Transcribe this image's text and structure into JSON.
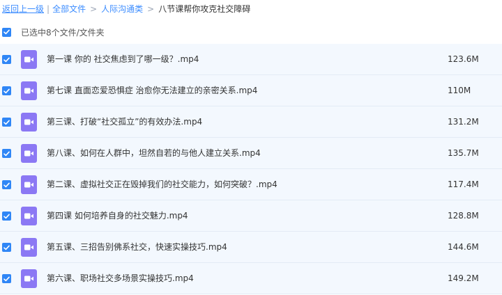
{
  "breadcrumb": {
    "back_label": "返回上一级",
    "separator": "|",
    "root_label": "全部文件",
    "folder_label": "人际沟通类",
    "current_label": "八节课帮你攻克社交障碍",
    "chevron": ">"
  },
  "selection": {
    "status_text": "已选中8个文件/文件夹",
    "all_checked": true
  },
  "colors": {
    "accent": "#2f86f6",
    "link": "#3b8cff",
    "row_selected_bg": "#f3f8fe",
    "video_icon_bg": "#8b78f4"
  },
  "icons": {
    "checkbox": "checkmark-icon",
    "file_type": "video-file-icon"
  },
  "files": [
    {
      "name": "第一课 你的 社交焦虑到了哪一级？.mp4",
      "size": "123.6M",
      "checked": true
    },
    {
      "name": "第七课 直面恋爱恐惧症 治愈你无法建立的亲密关系.mp4",
      "size": "110M",
      "checked": true
    },
    {
      "name": "第三课、打破“社交孤立”的有效办法.mp4",
      "size": "131.2M",
      "checked": true
    },
    {
      "name": "第八课、如何在人群中，坦然自若的与他人建立关系.mp4",
      "size": "135.7M",
      "checked": true
    },
    {
      "name": "第二课、虚拟社交正在毁掉我们的社交能力，如何突破？.mp4",
      "size": "117.4M",
      "checked": true
    },
    {
      "name": "第四课 如何培养自身的社交魅力.mp4",
      "size": "128.8M",
      "checked": true
    },
    {
      "name": "第五课、三招告别佛系社交，快速实操技巧.mp4",
      "size": "144.6M",
      "checked": true
    },
    {
      "name": "第六课、职场社交多场景实操技巧.mp4",
      "size": "149.2M",
      "checked": true
    }
  ]
}
